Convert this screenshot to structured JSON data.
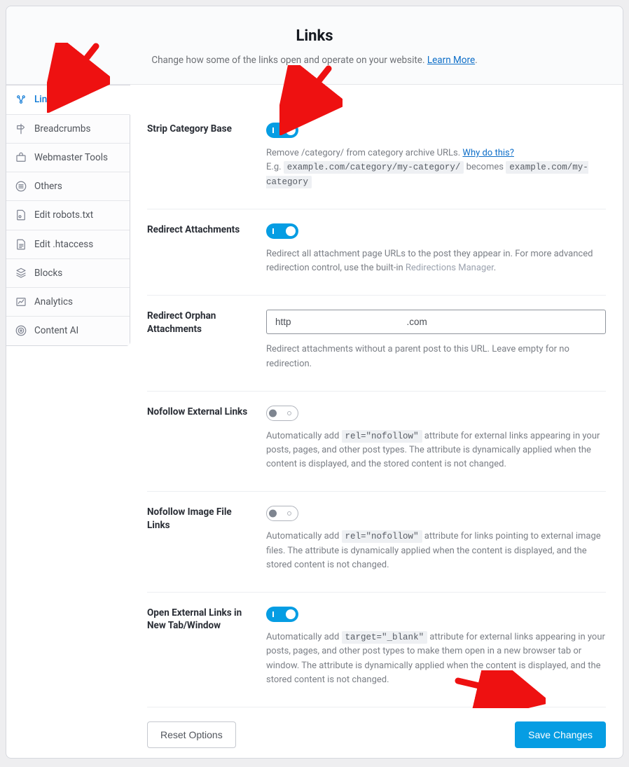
{
  "header": {
    "title": "Links",
    "subtitle_prefix": "Change how some of the links open and operate on your website. ",
    "learn_more": "Learn More"
  },
  "sidebar": {
    "items": [
      {
        "label": "Links"
      },
      {
        "label": "Breadcrumbs"
      },
      {
        "label": "Webmaster Tools"
      },
      {
        "label": "Others"
      },
      {
        "label": "Edit robots.txt"
      },
      {
        "label": "Edit .htaccess"
      },
      {
        "label": "Blocks"
      },
      {
        "label": "Analytics"
      },
      {
        "label": "Content AI"
      }
    ]
  },
  "rows": {
    "strip_category": {
      "label": "Strip Category Base",
      "on": true,
      "desc_pre": "Remove /category/ from category archive URLs. ",
      "why_link": "Why do this?",
      "eg_prefix": "E.g.",
      "code1": "example.com/category/my-category/",
      "becomes": "becomes",
      "code2": "example.com/my-category"
    },
    "redirect_attachments": {
      "label": "Redirect Attachments",
      "on": true,
      "desc_pre": "Redirect all attachment page URLs to the post they appear in. For more advanced redirection control, use the built-in ",
      "manager_link": "Redirections Manager",
      "period": "."
    },
    "redirect_orphan": {
      "label": "Redirect Orphan Attachments",
      "input_value": "http                                            .com",
      "desc": "Redirect attachments without a parent post to this URL. Leave empty for no redirection."
    },
    "nofollow_external": {
      "label": "Nofollow External Links",
      "on": false,
      "desc_pre": "Automatically add ",
      "code": "rel=\"nofollow\"",
      "desc_post": " attribute for external links appearing in your posts, pages, and other post types. The attribute is dynamically applied when the content is displayed, and the stored content is not changed."
    },
    "nofollow_image": {
      "label": "Nofollow Image File Links",
      "on": false,
      "desc_pre": "Automatically add ",
      "code": "rel=\"nofollow\"",
      "desc_post": " attribute for links pointing to external image files. The attribute is dynamically applied when the content is displayed, and the stored content is not changed."
    },
    "open_external": {
      "label": "Open External Links in New Tab/Window",
      "on": true,
      "desc_pre": "Automatically add ",
      "code": "target=\"_blank\"",
      "desc_post": " attribute for external links appearing in your posts, pages, and other post types to make them open in a new browser tab or window. The attribute is dynamically applied when the content is displayed, and the stored content is not changed."
    }
  },
  "footer": {
    "reset": "Reset Options",
    "save": "Save Changes"
  }
}
